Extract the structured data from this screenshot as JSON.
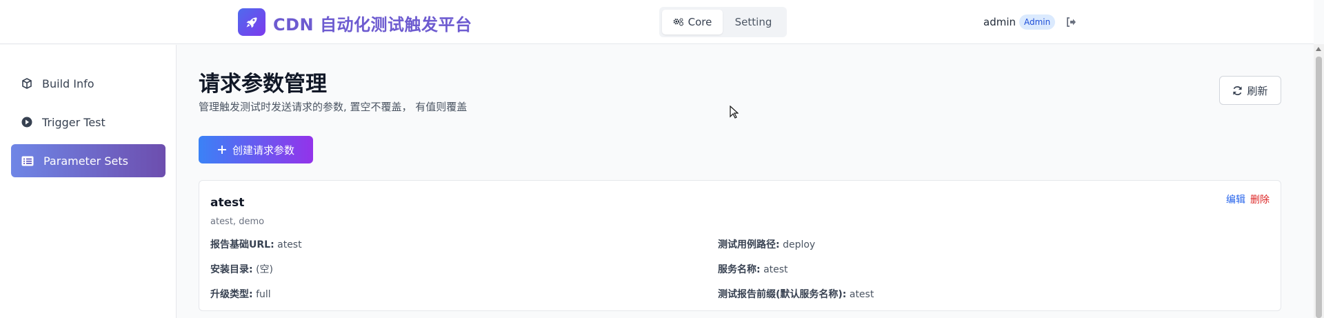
{
  "header": {
    "title": "CDN 自动化测试触发平台",
    "logo_icon": "rocket-icon",
    "tabs": [
      {
        "label": "Core",
        "icon": "gears-icon",
        "active": true
      },
      {
        "label": "Setting",
        "active": false
      }
    ],
    "user": {
      "name": "admin",
      "role": "Admin"
    },
    "logout_icon": "sign-out-icon"
  },
  "sidebar": {
    "items": [
      {
        "label": "Build Info",
        "icon": "cube-icon",
        "active": false
      },
      {
        "label": "Trigger Test",
        "icon": "play-circle-icon",
        "active": false
      },
      {
        "label": "Parameter Sets",
        "icon": "list-icon",
        "active": true
      }
    ]
  },
  "main": {
    "title": "请求参数管理",
    "subtitle": "管理触发测试时发送请求的参数, 置空不覆盖， 有值则覆盖",
    "refresh_label": "刷新",
    "create_label": "创建请求参数",
    "cards": [
      {
        "name": "atest",
        "tags": "atest, demo",
        "edit_label": "编辑",
        "delete_label": "删除",
        "fields": [
          {
            "label": "报告基础URL:",
            "value": "atest"
          },
          {
            "label": "测试用例路径:",
            "value": "deploy"
          },
          {
            "label": "安装目录:",
            "value": "(空)"
          },
          {
            "label": "服务名称:",
            "value": "atest"
          },
          {
            "label": "升级类型:",
            "value": "full"
          },
          {
            "label": "测试报告前缀(默认服务名称):",
            "value": "atest"
          }
        ]
      }
    ]
  },
  "colors": {
    "accent_start": "#3b82f6",
    "accent_end": "#9333ea",
    "title_color": "#6d5bd0",
    "edit_color": "#2563eb",
    "delete_color": "#dc2626"
  }
}
